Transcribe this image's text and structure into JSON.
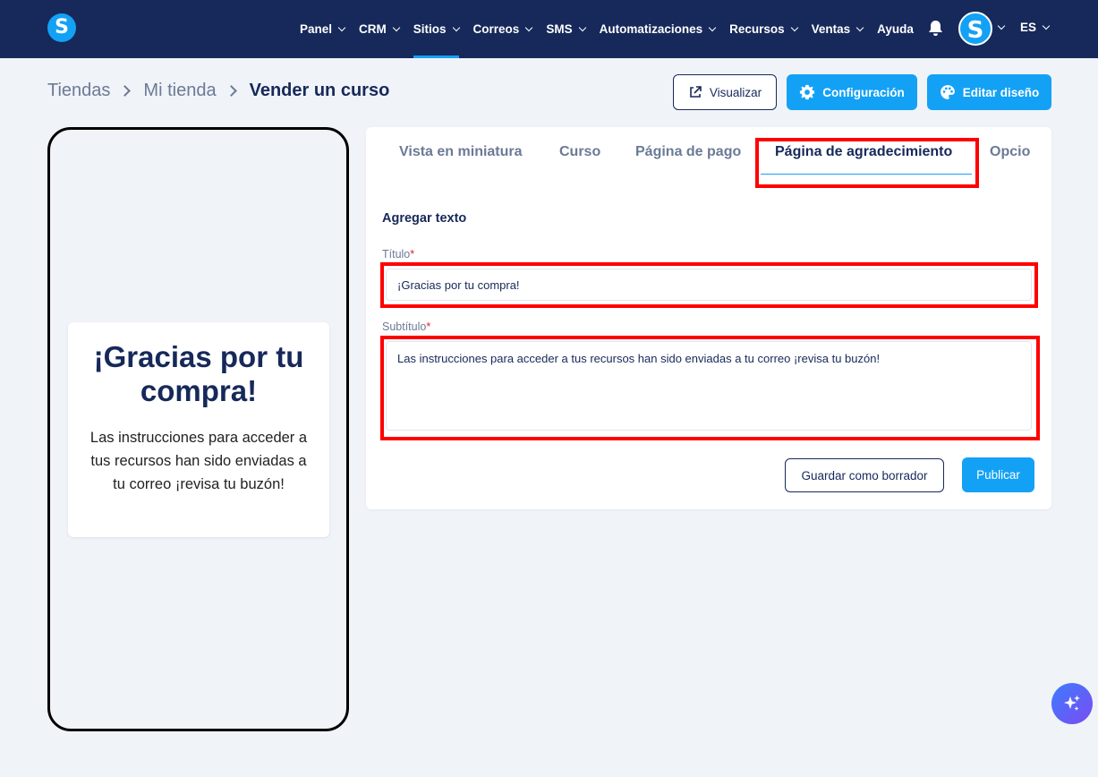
{
  "nav": {
    "items": [
      {
        "label": "Panel",
        "chevron": true
      },
      {
        "label": "CRM",
        "chevron": true
      },
      {
        "label": "Sitios",
        "chevron": true,
        "active": true
      },
      {
        "label": "Correos",
        "chevron": true
      },
      {
        "label": "SMS",
        "chevron": true
      },
      {
        "label": "Automatizaciones",
        "chevron": true
      },
      {
        "label": "Recursos",
        "chevron": true
      },
      {
        "label": "Ventas",
        "chevron": true
      },
      {
        "label": "Ayuda",
        "chevron": false
      }
    ],
    "logo_letter": "S",
    "avatar_letter": "S",
    "language": "ES",
    "bell_icon": "bell-icon"
  },
  "breadcrumb": {
    "items": [
      "Tiendas",
      "Mi tienda",
      "Vender un curso"
    ]
  },
  "actions": {
    "preview_label": "Visualizar",
    "settings_label": "Configuración",
    "edit_design_label": "Editar diseño"
  },
  "preview": {
    "title": "¡Gracias por tu compra!",
    "subtitle": "Las instrucciones para acceder a tus recursos han sido enviadas a tu correo ¡revisa tu buzón!"
  },
  "tabs": {
    "items": [
      "Vista en miniatura",
      "Curso",
      "Página de pago",
      "Página de agradecimiento",
      "Opcio"
    ],
    "active_index": 3
  },
  "form": {
    "section_title": "Agregar texto",
    "title_label": "Título",
    "title_value": "¡Gracias por tu compra!",
    "subtitle_label": "Subtítulo",
    "subtitle_value": "Las instrucciones para acceder a tus recursos han sido enviadas a tu correo ¡revisa tu buzón!",
    "required_mark": "*",
    "draft_label": "Guardar como borrador",
    "publish_label": "Publicar"
  },
  "colors": {
    "navbar": "#16295a",
    "accent": "#13a1f5",
    "highlight": "#ff0000"
  }
}
